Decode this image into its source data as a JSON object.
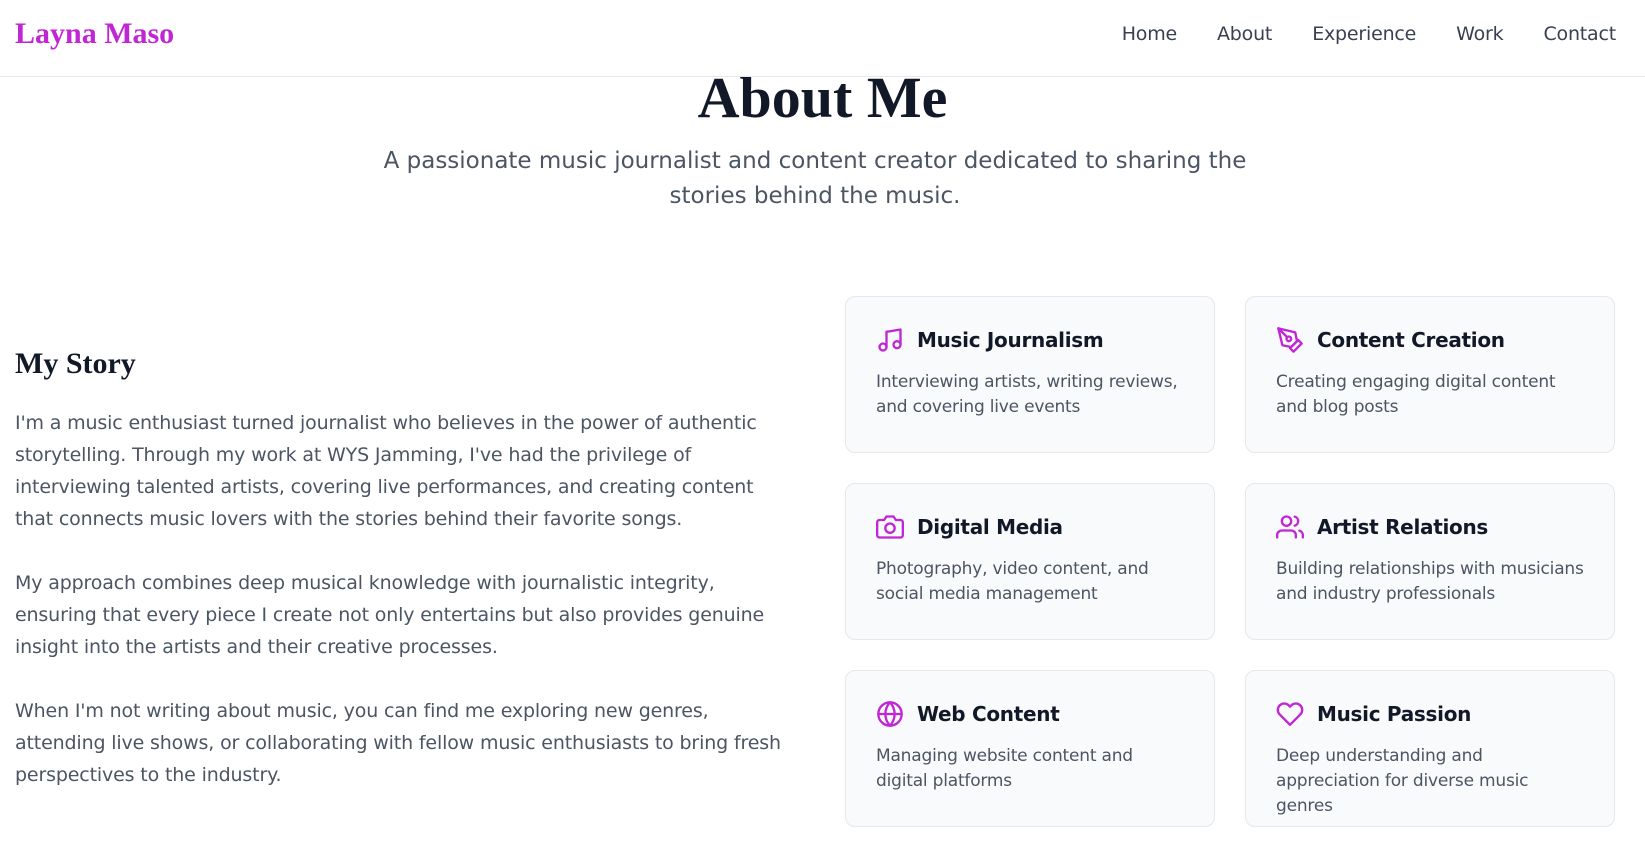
{
  "header": {
    "brand": "Layna Maso",
    "nav": [
      {
        "label": "Home"
      },
      {
        "label": "About"
      },
      {
        "label": "Experience"
      },
      {
        "label": "Work"
      },
      {
        "label": "Contact"
      }
    ]
  },
  "hero": {
    "title": "About Me",
    "subtitle": "A passionate music journalist and content creator dedicated to sharing the stories behind the music."
  },
  "story": {
    "heading": "My Story",
    "paragraphs": [
      "I'm a music enthusiast turned journalist who believes in the power of authentic storytelling. Through my work at WYS Jamming, I've had the privilege of interviewing talented artists, covering live performances, and creating content that connects music lovers with the stories behind their favorite songs.",
      "My approach combines deep musical knowledge with journalistic integrity, ensuring that every piece I create not only entertains but also provides genuine insight into the artists and their creative processes.",
      "When I'm not writing about music, you can find me exploring new genres, attending live shows, or collaborating with fellow music enthusiasts to bring fresh perspectives to the industry."
    ]
  },
  "skills": [
    {
      "icon": "music-note-icon",
      "title": "Music Journalism",
      "desc": "Interviewing artists, writing reviews, and covering live events"
    },
    {
      "icon": "pen-tool-icon",
      "title": "Content Creation",
      "desc": "Creating engaging digital content and blog posts"
    },
    {
      "icon": "camera-icon",
      "title": "Digital Media",
      "desc": "Photography, video content, and social media management"
    },
    {
      "icon": "users-icon",
      "title": "Artist Relations",
      "desc": "Building relationships with musicians and industry professionals"
    },
    {
      "icon": "globe-icon",
      "title": "Web Content",
      "desc": "Managing website content and digital platforms"
    },
    {
      "icon": "heart-icon",
      "title": "Music Passion",
      "desc": "Deep understanding and appreciation for diverse music genres"
    }
  ],
  "colors": {
    "accent": "#c026d3",
    "text_dark": "#111827",
    "text_muted": "#4b5563",
    "card_bg": "#f9fafb",
    "border": "#e5e7eb"
  }
}
